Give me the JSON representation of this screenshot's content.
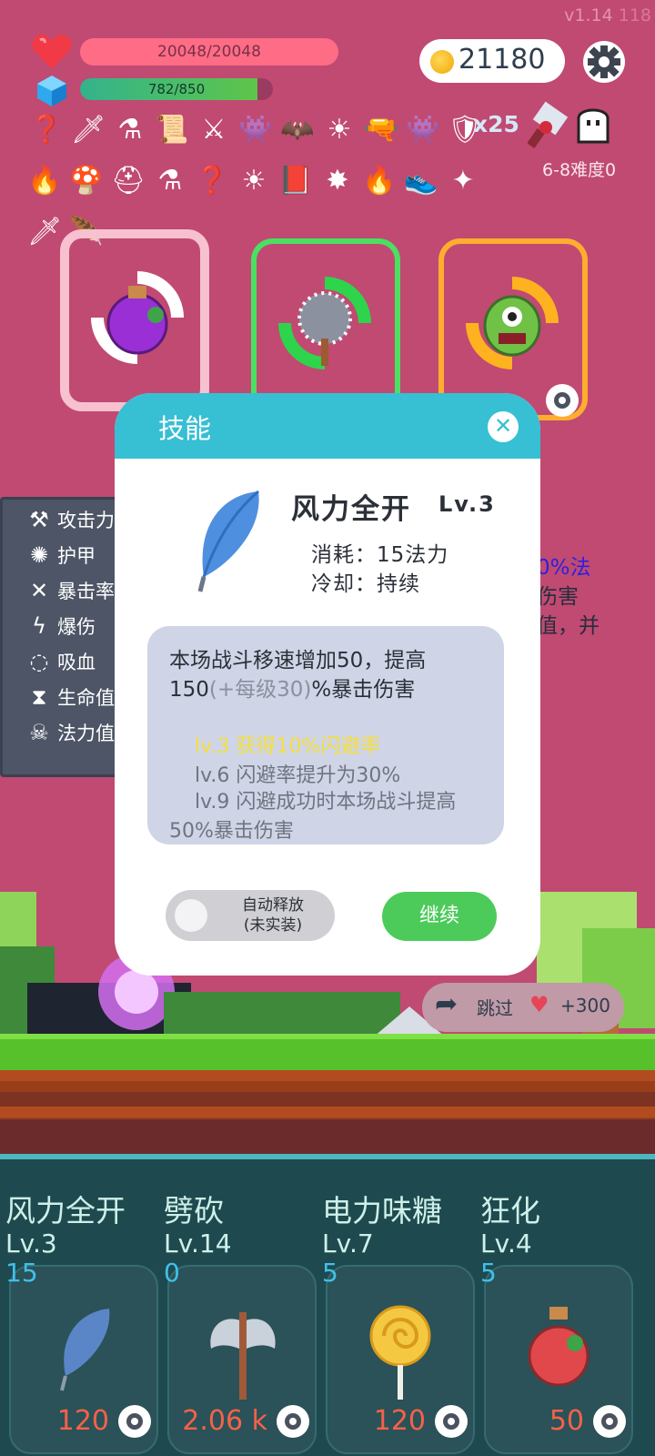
{
  "version": {
    "main": "v1.14",
    "build": "118"
  },
  "status": {
    "hp_text": "20048/20048",
    "hp_fraction": 1.0,
    "mp_text": "782/850",
    "mp_fraction": 0.92
  },
  "gold": "21180",
  "items_row1": [
    "hook-icon",
    "dagger-icon",
    "mortar-icon",
    "scroll-icon",
    "sword-icon",
    "green-slime-icon",
    "bat-icon",
    "sun-icon",
    "gun-icon",
    "green-monster-icon",
    "shield-icon"
  ],
  "items_row2": [
    "torch-icon",
    "mushroom-icon",
    "viking-helmet-icon",
    "mortar-icon",
    "hook-icon",
    "sun-icon",
    "spellbook-icon",
    "spiked-ball-icon",
    "torch-icon",
    "sneaker-icon",
    "mace-icon"
  ],
  "items_row3": [
    "dagger-icon",
    "feather-icon"
  ],
  "shield_count": "x25",
  "difficulty": "6-8难度0",
  "cards": [
    "purple-potion-icon",
    "spiked-mace-icon",
    "green-monster-icon"
  ],
  "stats": [
    "攻击力",
    "护甲",
    "暴击率",
    "爆伤",
    "吸血",
    "生命值",
    "法力值"
  ],
  "right_text": [
    "0%法",
    "伤害",
    "值，并"
  ],
  "skip": {
    "label": "跳过",
    "reward": "+300"
  },
  "modal": {
    "title": "技能",
    "skill_name": "风力全开",
    "skill_level": "Lv.3",
    "cost": "消耗：15法力",
    "cooldown": "冷却：持续",
    "desc_main_a": "本场战斗移速增加50，提高150",
    "desc_main_b": "(+每级30)",
    "desc_main_c": "%暴击伤害",
    "lv3": "lv.3  获得10%闪避率",
    "lv6": "lv.6  闪避率提升为30%",
    "lv9": "lv.9  闪避成功时本场战斗提高50%暴击伤害",
    "auto_label": "自动释放",
    "auto_sub": "(未实装)",
    "continue": "继续"
  },
  "skills": [
    {
      "name": "风力全开",
      "level": "Lv.3",
      "cost": "15",
      "price": "120",
      "icon": "feather-icon"
    },
    {
      "name": "劈砍",
      "level": "Lv.14",
      "cost": "0",
      "price": "2.06 k",
      "icon": "battle-axe-icon"
    },
    {
      "name": "电力味糖",
      "level": "Lv.7",
      "cost": "5",
      "price": "120",
      "icon": "lollipop-icon"
    },
    {
      "name": "狂化",
      "level": "Lv.4",
      "cost": "5",
      "price": "50",
      "icon": "red-potion-icon"
    }
  ]
}
